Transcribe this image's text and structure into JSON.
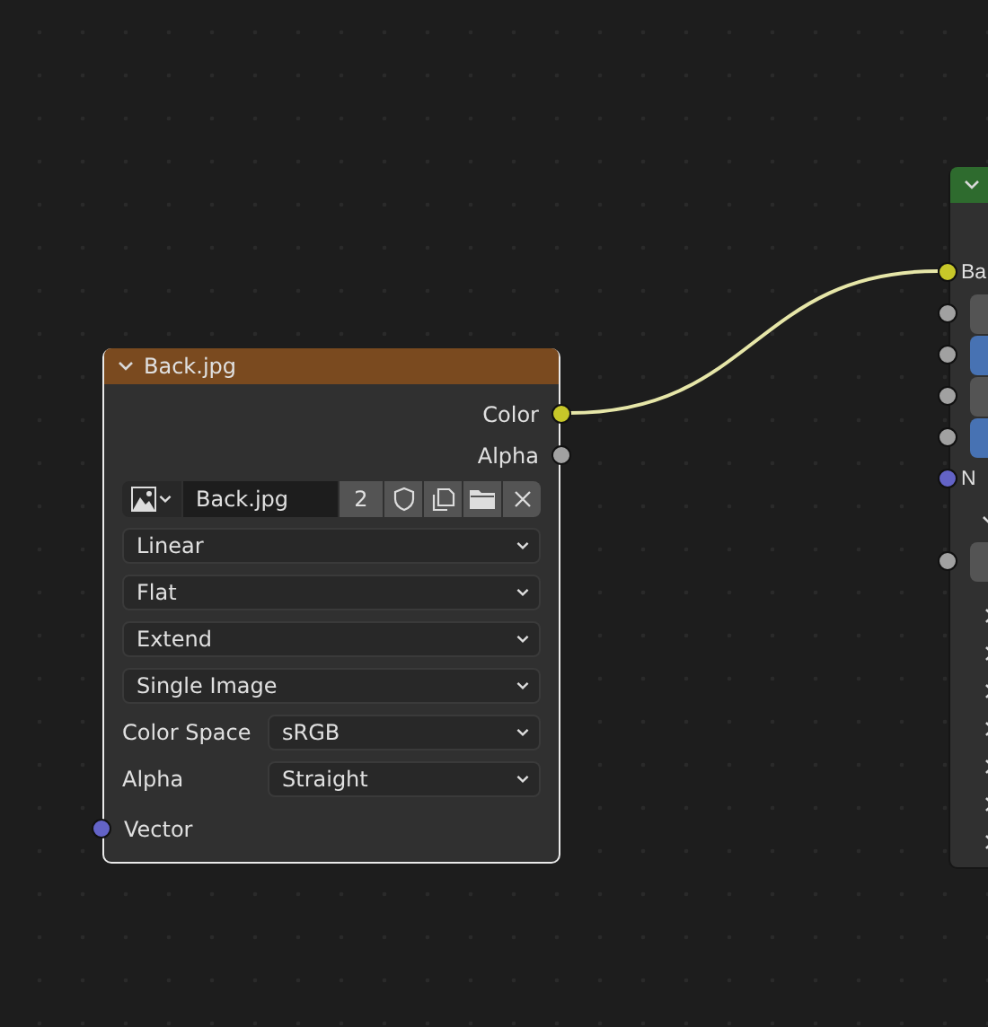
{
  "nodes": [
    {
      "kind": "image",
      "selected": true,
      "expanded": true,
      "title": "Back.jpg",
      "outputs": [
        {
          "label": "Color",
          "color": "#c7c729"
        },
        {
          "label": "Alpha",
          "color": "#a1a1a1"
        }
      ],
      "image": {
        "name": "Back.jpg",
        "users": "2"
      },
      "dropdowns": [
        {
          "value": "Linear"
        },
        {
          "value": "Flat"
        },
        {
          "value": "Extend"
        },
        {
          "value": "Single Image"
        }
      ],
      "props": [
        {
          "label": "Color Space",
          "value": "sRGB"
        },
        {
          "label": "Alpha",
          "value": "Straight"
        }
      ],
      "inputs": [
        {
          "label": "Vector",
          "color": "#6363c7"
        }
      ]
    },
    {
      "kind": "shader",
      "selected": false,
      "expanded": true,
      "rows": [
        {
          "kind": "socket",
          "label": "Ba",
          "color": "#c7c729"
        },
        {
          "kind": "field",
          "color": "#a1a1a1"
        },
        {
          "kind": "slider",
          "color": "#a1a1a1"
        },
        {
          "kind": "field",
          "color": "#a1a1a1"
        },
        {
          "kind": "slider",
          "color": "#a1a1a1"
        },
        {
          "kind": "socket",
          "label": "N",
          "color": "#6363c7"
        },
        {
          "kind": "panel",
          "expanded": true
        },
        {
          "kind": "field",
          "color": "#a1a1a1"
        },
        {
          "kind": "panel",
          "expanded": false
        },
        {
          "kind": "panel",
          "expanded": false
        },
        {
          "kind": "panel",
          "expanded": false
        },
        {
          "kind": "panel",
          "expanded": false
        },
        {
          "kind": "panel",
          "expanded": false
        },
        {
          "kind": "panel",
          "expanded": false
        },
        {
          "kind": "panel",
          "expanded": false
        }
      ]
    }
  ]
}
